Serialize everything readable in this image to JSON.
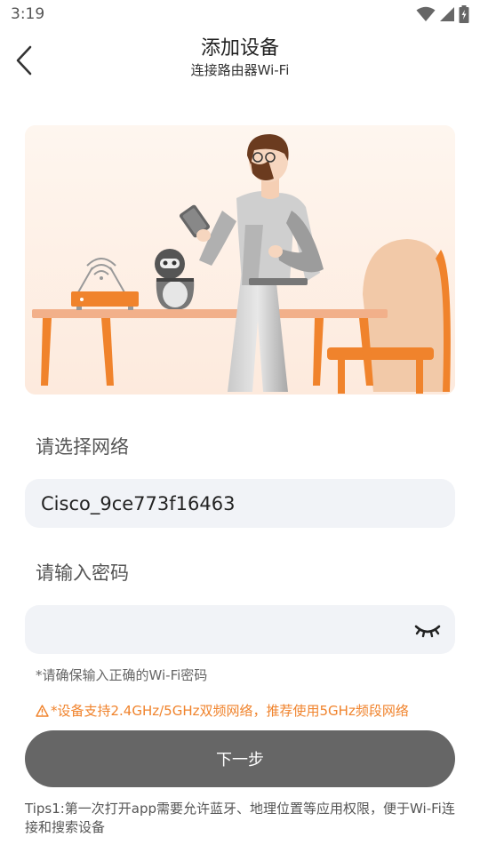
{
  "status_bar": {
    "time": "3:19",
    "icons": [
      "wifi-icon",
      "cell-signal-icon",
      "battery-charging-icon"
    ]
  },
  "header": {
    "title": "添加设备",
    "subtitle": "连接路由器Wi-Fi",
    "back_icon": "chevron-left-icon"
  },
  "illustration": {
    "description_icon": "setup-illustration",
    "colors": {
      "background": "#fdf2ea",
      "accent": "#f0832c"
    }
  },
  "network": {
    "label": "请选择网络",
    "value": "Cisco_9ce773f16463"
  },
  "password": {
    "label": "请输入密码",
    "value": "",
    "placeholder": "",
    "toggle_icon": "eye-closed-icon"
  },
  "hint": "*请确保输入正确的Wi-Fi密码",
  "warning": {
    "icon": "warning-triangle-icon",
    "text": "*设备支持2.4GHz/5GHz双频网络，推荐使用5GHz频段网络"
  },
  "next_button": {
    "label": "下一步"
  },
  "tips": "Tips1:第一次打开app需要允许蓝牙、地理位置等应用权限，便于Wi-Fi连接和搜索设备",
  "colors": {
    "accent": "#f0832c",
    "button": "#666666",
    "field_bg": "#f1f3f7"
  }
}
